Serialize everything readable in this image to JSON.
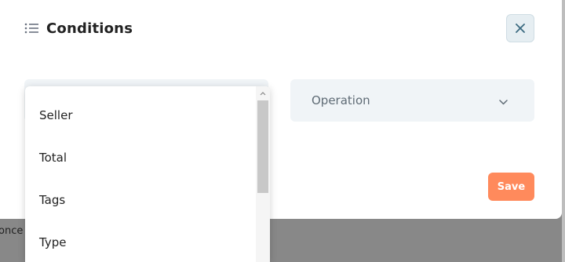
{
  "backdrop": {
    "partial_text": "once"
  },
  "modal": {
    "title": "Conditions",
    "title_icon": "list-icon",
    "close_icon": "close-icon",
    "save_label": "Save"
  },
  "fields": {
    "property": {
      "value": ""
    },
    "operation": {
      "placeholder": "Operation",
      "icon": "chevron-down-icon"
    }
  },
  "dropdown": {
    "options": [
      "Seller",
      "Total",
      "Tags",
      "Type"
    ]
  },
  "colors": {
    "save_button": "#ff8a5c",
    "close_button_bg": "#e6eef2",
    "field_bg": "#f0f4f7"
  }
}
